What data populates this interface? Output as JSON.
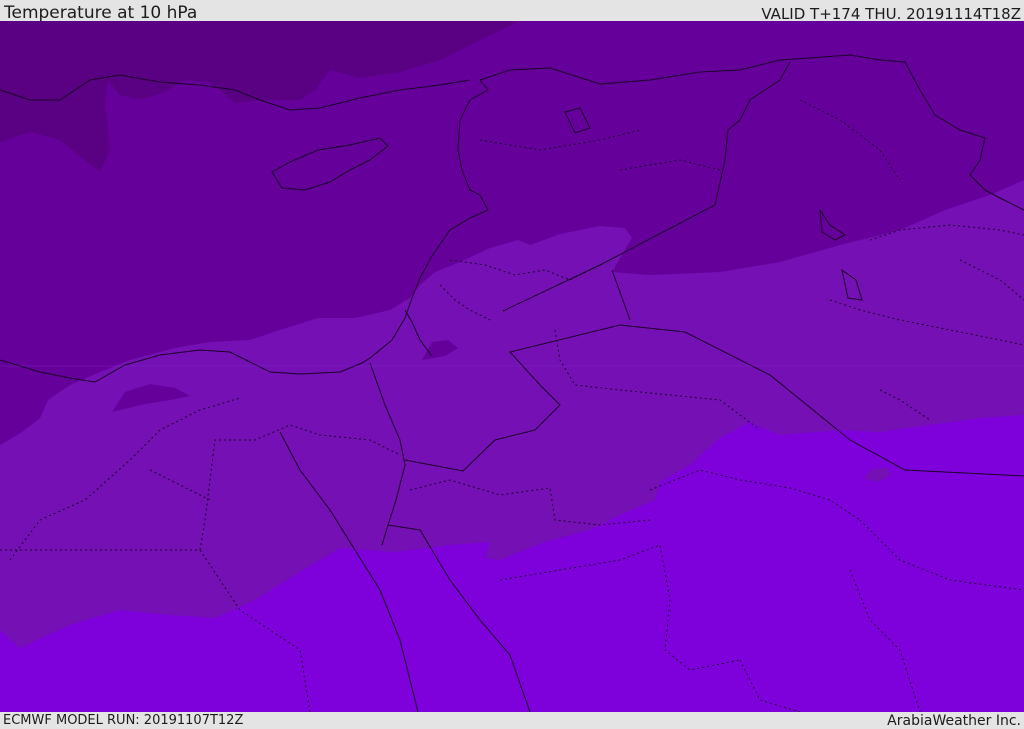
{
  "header": {
    "title": "Temperature at 10 hPa",
    "valid_time": "VALID T+174 THU. 20191114T18Z"
  },
  "footer": {
    "model_run": "ECMWF MODEL RUN: 20191107T12Z",
    "credit": "ArabiaWeather Inc."
  },
  "map": {
    "field": "temperature",
    "level": "10 hPa",
    "colors": {
      "darkest": "#5a0082",
      "dark": "#65009a",
      "mid": "#7410b4",
      "light": "#7e00da",
      "lines": "#1a0028"
    }
  }
}
